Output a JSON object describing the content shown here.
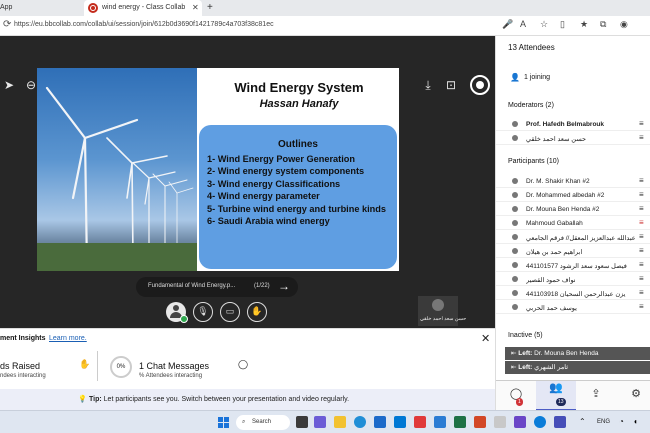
{
  "browser": {
    "tab1_title": "App",
    "tab2_title": "wind energy - Class Collab",
    "url": "https://eu.bbcollab.com/collab/ui/session/join/612b0d3690f1421789c4a703f38c81ec"
  },
  "meeting": {
    "slide": {
      "title": "Wind Energy System",
      "author": "Hassan Hanafy",
      "outline_heading": "Outlines",
      "outline_items": [
        "1- Wind Energy Power Generation",
        "2- Wind energy system components",
        "3- Wind energy Classifications",
        "4- Wind energy parameter",
        "5- Turbine wind energy and turbine kinds",
        "6- Saudi Arabia wind energy"
      ]
    },
    "slide_nav": {
      "file_name": "Fundamental of Wind Energy.p...",
      "counter": "(1/22)"
    },
    "camera_tile_name": "حسن سعد احمد خلقي"
  },
  "insights": {
    "title": "ment Insights",
    "learn_more": "Learn more.",
    "hands_title": "ds Raised",
    "hands_sub": "ndees interacting",
    "chat_percent": "0%",
    "chat_title": "1 Chat Messages",
    "chat_sub": "% Attendees interacting"
  },
  "tip": {
    "label": "Tip:",
    "text": "Let participants see you. Switch between your presentation and video regularly."
  },
  "attendees": {
    "title": "13 Attendees",
    "joining": "1 joining",
    "moderators_header": "Moderators (2)",
    "moderators": [
      "Prof. Hafedh Belmabrouk",
      "حسن سعد احمد خلقي"
    ],
    "participants_header": "Participants (10)",
    "participants": [
      "Dr. M. Shakir Khan #2",
      "Dr. Mohammed albedah #2",
      "Dr. Mouna Ben Henda #2",
      "Mahmoud Gaballah",
      "احمد عبدالله عبدالعزيز المعقل// فرقم الجامعي:...",
      "ابراهيم حمد بن هيلان",
      "فيصل سعود سعد الرشود 441101577",
      "نواف حمود القصير",
      "يزن عبدالرحمن السحيان 441103918",
      "يوسف حمد الحربي"
    ],
    "inactive_header": "Inactive (5)",
    "inactive": [
      {
        "label": "Left:",
        "name": "Dr. Mouna Ben Henda"
      },
      {
        "label": "Left:",
        "name": "ثامر الشهري"
      }
    ],
    "chat_badge": "1",
    "people_badge": "13"
  },
  "taskbar": {
    "search": "Search",
    "lang": "ENG"
  },
  "colors": {
    "meeting_bg": "#262626",
    "outline_box": "#5f9ee2",
    "accent": "#4c5cc5",
    "badge_red": "#d13438"
  }
}
